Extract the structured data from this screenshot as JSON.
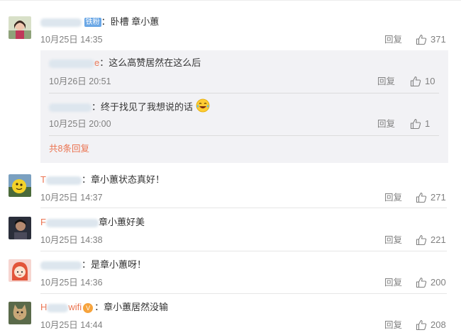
{
  "comments": [
    {
      "user_visible": "",
      "user_badge": "铁粉",
      "text": "：卧槽 章小蕙",
      "time": "10月25日 14:35",
      "reply_label": "回复",
      "likes": "371",
      "avatar_icon": "avatar-woman-portrait-icon"
    },
    {
      "user_visible": "T",
      "text": "：章小蕙状态真好！",
      "time": "10月25日 14:37",
      "reply_label": "回复",
      "likes": "271",
      "avatar_icon": "avatar-yellow-fruit-icon"
    },
    {
      "user_visible": "F",
      "text": "章小蕙好美",
      "time": "10月25日 14:38",
      "reply_label": "回复",
      "likes": "221",
      "avatar_icon": "avatar-dark-portrait-icon"
    },
    {
      "user_visible": "",
      "text": "：是章小蕙呀！",
      "time": "10月25日 14:36",
      "reply_label": "回复",
      "likes": "200",
      "avatar_icon": "avatar-cartoon-girl-icon"
    },
    {
      "user_visible": "H",
      "user_tail": "wifi",
      "text": "：章小蕙居然没输",
      "time": "10月25日 14:44",
      "reply_label": "回复",
      "likes": "208",
      "avatar_icon": "avatar-cat-icon"
    }
  ],
  "sub_replies": [
    {
      "user_tail": "e",
      "text": "：这么高赞居然在这么后",
      "time": "10月26日 20:51",
      "reply_label": "回复",
      "likes": "10"
    },
    {
      "user_tail": "",
      "text": "：终于找见了我想说的话",
      "emoji": "laughing-tears-emoji",
      "time": "10月25日 20:00",
      "reply_label": "回复",
      "likes": "1"
    }
  ],
  "more_replies_label": "共8条回复",
  "colors": {
    "accent": "#eb7350",
    "meta": "#808080",
    "subbox_bg": "#f2f2f5"
  }
}
